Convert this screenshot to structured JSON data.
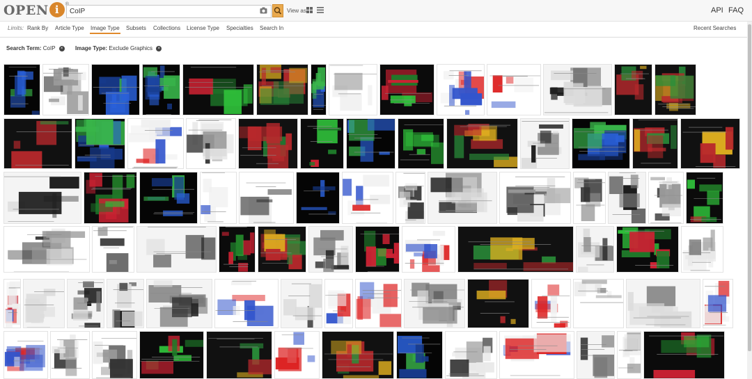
{
  "logo": {
    "text": "OPEN",
    "i_letter": "i"
  },
  "search": {
    "value": "CoIP"
  },
  "view_as_label": "View as",
  "toplinks": {
    "api": "API",
    "faq": "FAQ"
  },
  "filters": {
    "limits_label": "Limits:",
    "items": [
      "Rank By",
      "Article Type",
      "Image Type",
      "Subsets",
      "Collections",
      "License Type",
      "Specialties",
      "Search In"
    ],
    "active": "Image Type",
    "recent_searches": "Recent Searches"
  },
  "search_terms": [
    {
      "label": "Search Term:",
      "value": "CoIP"
    },
    {
      "label": "Image Type:",
      "value": "Exclude Graphics"
    }
  ],
  "colors": {
    "accent": "#e08a2c",
    "logo_i": "#d9862b",
    "search_button": "#e9a94d"
  },
  "results_grid": {
    "rows": 6
  }
}
